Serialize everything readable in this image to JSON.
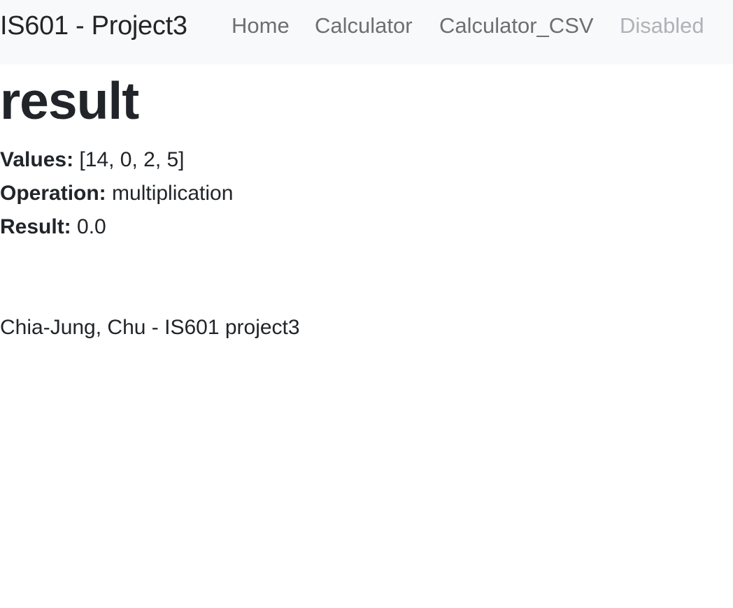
{
  "navbar": {
    "brand": "IS601 - Project3",
    "links": [
      {
        "label": "Home"
      },
      {
        "label": "Calculator"
      },
      {
        "label": "Calculator_CSV"
      },
      {
        "label": "Disabled"
      }
    ]
  },
  "main": {
    "title": "result",
    "values_label": "Values:",
    "values": "[14, 0, 2, 5]",
    "operation_label": "Operation:",
    "operation": "multiplication",
    "result_label": "Result:",
    "result": "0.0"
  },
  "footer": {
    "text": "Chia-Jung, Chu - IS601 project3"
  }
}
